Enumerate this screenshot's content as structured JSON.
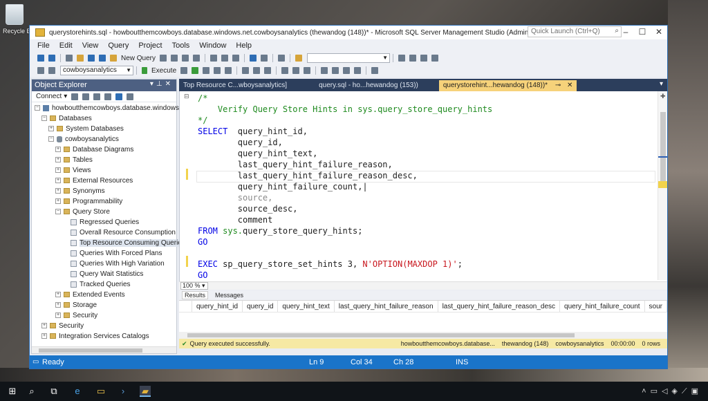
{
  "desktop": {
    "recycle_bin_label": "Recycle Bi"
  },
  "window": {
    "title": "querystorehints.sql - howboutthemcowboys.database.windows.net.cowboysanalytics (thewandog (148))* - Microsoft SQL Server Management Studio (Administrator)",
    "quick_launch_placeholder": "Quick Launch (Ctrl+Q)",
    "controls": {
      "minimize": "–",
      "maximize": "☐",
      "close": "✕"
    }
  },
  "menu": [
    "File",
    "Edit",
    "View",
    "Query",
    "Project",
    "Tools",
    "Window",
    "Help"
  ],
  "toolbar": {
    "new_query_label": "New Query",
    "database_selected": "cowboysanalytics",
    "execute_label": "Execute"
  },
  "object_explorer": {
    "title": "Object Explorer",
    "connect_label": "Connect",
    "tree": [
      {
        "label": "howboutthemcowboys.database.windows.n",
        "indent": 0,
        "icon": "server",
        "exp": "−"
      },
      {
        "label": "Databases",
        "indent": 1,
        "icon": "folder",
        "exp": "−"
      },
      {
        "label": "System Databases",
        "indent": 2,
        "icon": "folder",
        "exp": "+"
      },
      {
        "label": "cowboysanalytics",
        "indent": 2,
        "icon": "database",
        "exp": "−"
      },
      {
        "label": "Database Diagrams",
        "indent": 3,
        "icon": "folder",
        "exp": "+"
      },
      {
        "label": "Tables",
        "indent": 3,
        "icon": "folder",
        "exp": "+"
      },
      {
        "label": "Views",
        "indent": 3,
        "icon": "folder",
        "exp": "+"
      },
      {
        "label": "External Resources",
        "indent": 3,
        "icon": "folder",
        "exp": "+"
      },
      {
        "label": "Synonyms",
        "indent": 3,
        "icon": "folder",
        "exp": "+"
      },
      {
        "label": "Programmability",
        "indent": 3,
        "icon": "folder",
        "exp": "+"
      },
      {
        "label": "Query Store",
        "indent": 3,
        "icon": "folder",
        "exp": "−"
      },
      {
        "label": "Regressed Queries",
        "indent": 4,
        "icon": "report",
        "exp": ""
      },
      {
        "label": "Overall Resource Consumption",
        "indent": 4,
        "icon": "report",
        "exp": ""
      },
      {
        "label": "Top Resource Consuming Queries",
        "indent": 4,
        "icon": "report",
        "exp": "",
        "selected": true
      },
      {
        "label": "Queries With Forced Plans",
        "indent": 4,
        "icon": "report",
        "exp": ""
      },
      {
        "label": "Queries With High Variation",
        "indent": 4,
        "icon": "report",
        "exp": ""
      },
      {
        "label": "Query Wait Statistics",
        "indent": 4,
        "icon": "report",
        "exp": ""
      },
      {
        "label": "Tracked Queries",
        "indent": 4,
        "icon": "report",
        "exp": ""
      },
      {
        "label": "Extended Events",
        "indent": 3,
        "icon": "folder",
        "exp": "+"
      },
      {
        "label": "Storage",
        "indent": 3,
        "icon": "folder",
        "exp": "+"
      },
      {
        "label": "Security",
        "indent": 3,
        "icon": "folder",
        "exp": "+"
      },
      {
        "label": "Security",
        "indent": 1,
        "icon": "folder",
        "exp": "+"
      },
      {
        "label": "Integration Services Catalogs",
        "indent": 1,
        "icon": "folder",
        "exp": "+"
      }
    ]
  },
  "tabs": [
    {
      "label": "Top Resource C...wboysanalytics]",
      "active": false
    },
    {
      "label": "query.sql - ho...hewandog (153))",
      "active": false
    },
    {
      "label": "querystorehint...hewandog (148))*",
      "active": true
    }
  ],
  "code_lines": [
    [
      {
        "t": "/*",
        "c": "cm"
      }
    ],
    [
      {
        "t": "    Verify Query Store Hints in sys.query_store_query_hints",
        "c": "cm"
      }
    ],
    [
      {
        "t": "*/",
        "c": "cm"
      }
    ],
    [
      {
        "t": "SELECT",
        "c": "kw"
      },
      {
        "t": "  query_hint_id,",
        "c": ""
      }
    ],
    [
      {
        "t": "        query_id,",
        "c": ""
      }
    ],
    [
      {
        "t": "        query_hint_text,",
        "c": ""
      }
    ],
    [
      {
        "t": "        last_query_hint_failure_reason,",
        "c": ""
      }
    ],
    [
      {
        "t": "        last_query_hint_failure_reason_desc,",
        "c": ""
      }
    ],
    [
      {
        "t": "        query_hint_failure_count,",
        "c": ""
      },
      {
        "t": "|",
        "c": ""
      }
    ],
    [
      {
        "t": "        source,",
        "c": "gr"
      }
    ],
    [
      {
        "t": "        source_desc,",
        "c": ""
      }
    ],
    [
      {
        "t": "        comment",
        "c": ""
      }
    ],
    [
      {
        "t": "FROM",
        "c": "kw"
      },
      {
        "t": " sys.",
        "c": "fn"
      },
      {
        "t": "query_store_query_hints;",
        "c": ""
      }
    ],
    [
      {
        "t": "GO",
        "c": "kw"
      }
    ],
    [
      {
        "t": "",
        "c": ""
      }
    ],
    [
      {
        "t": "EXEC",
        "c": "kw"
      },
      {
        "t": " sp_query_store_set_hints 3, ",
        "c": ""
      },
      {
        "t": "N'OPTION(MAXDOP 1)'",
        "c": "str"
      },
      {
        "t": ";",
        "c": ""
      }
    ],
    [
      {
        "t": "GO",
        "c": "kw"
      }
    ]
  ],
  "editor": {
    "zoom": "100 %"
  },
  "results": {
    "tabs": [
      "Results",
      "Messages"
    ],
    "columns": [
      "query_hint_id",
      "query_id",
      "query_hint_text",
      "last_query_hint_failure_reason",
      "last_query_hint_failure_reason_desc",
      "query_hint_failure_count",
      "sour"
    ]
  },
  "query_status": {
    "message": "Query executed successfully.",
    "server": "howboutthemcowboys.database...",
    "user": "thewandog (148)",
    "database": "cowboysanalytics",
    "elapsed": "00:00:00",
    "rows": "0 rows"
  },
  "statusbar": {
    "ready": "Ready",
    "ln": "Ln 9",
    "col": "Col 34",
    "ch": "Ch 28",
    "mode": "INS"
  },
  "colors": {
    "accent": "#1a74c9",
    "active_tab": "#f6d27a",
    "keyword": "#0000e6",
    "comment": "#1e8a1e",
    "string": "#c8161d"
  }
}
